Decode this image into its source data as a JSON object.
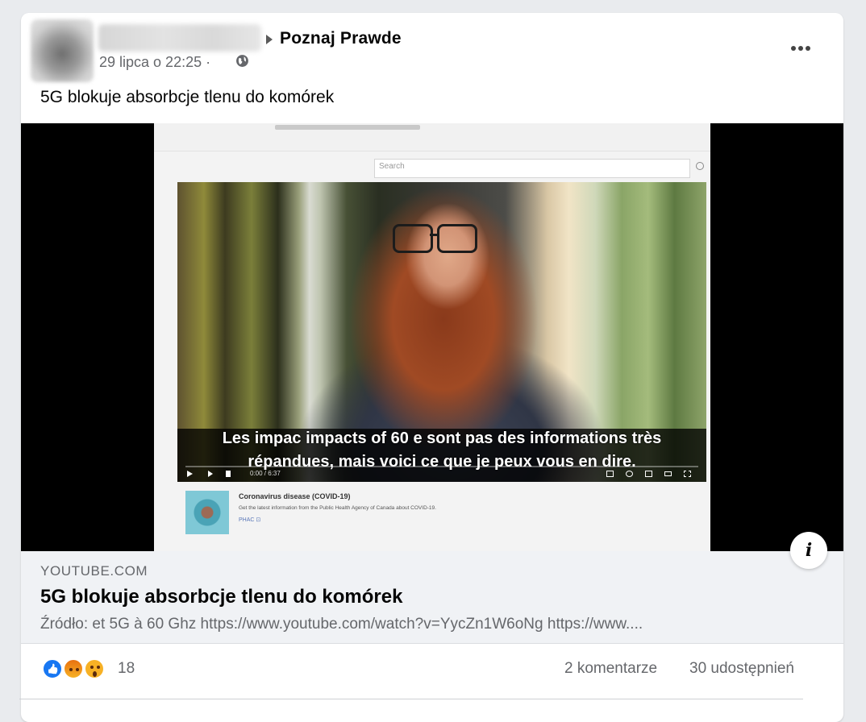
{
  "post": {
    "page_name": "Poznaj Prawde",
    "timestamp": "29 lipca o 22:25 ·",
    "privacy_icon": "globe-icon",
    "text": "5G blokuje absorbcje tlenu do komórek"
  },
  "video": {
    "search_placeholder": "Search",
    "caption_line1": "Les impac impacts of 60 e sont pas des informations très",
    "caption_line2": "répandues, mais voici ce que je peux vous en dire.",
    "time": "0:00 / 6:37",
    "recommendation": {
      "title": "Coronavirus disease (COVID-19)",
      "subtitle": "Get the latest information from the Public Health Agency of Canada about COVID-19.",
      "source": "PHAC ⊡"
    }
  },
  "link": {
    "domain": "YOUTUBE.COM",
    "title": "5G blokuje absorbcje tlenu do komórek",
    "description": "Źródło: et 5G à 60 Ghz https://www.youtube.com/watch?v=YycZn1W6oNg https://www...."
  },
  "stats": {
    "reaction_icons": [
      "like-icon",
      "angry-icon",
      "wow-icon"
    ],
    "reaction_count": "18",
    "comments": "2 komentarze",
    "shares": "30 udostępnień"
  },
  "colors": {
    "like": "#1877f2",
    "secondary_text": "#65676b",
    "link_bg": "#f0f2f5"
  }
}
